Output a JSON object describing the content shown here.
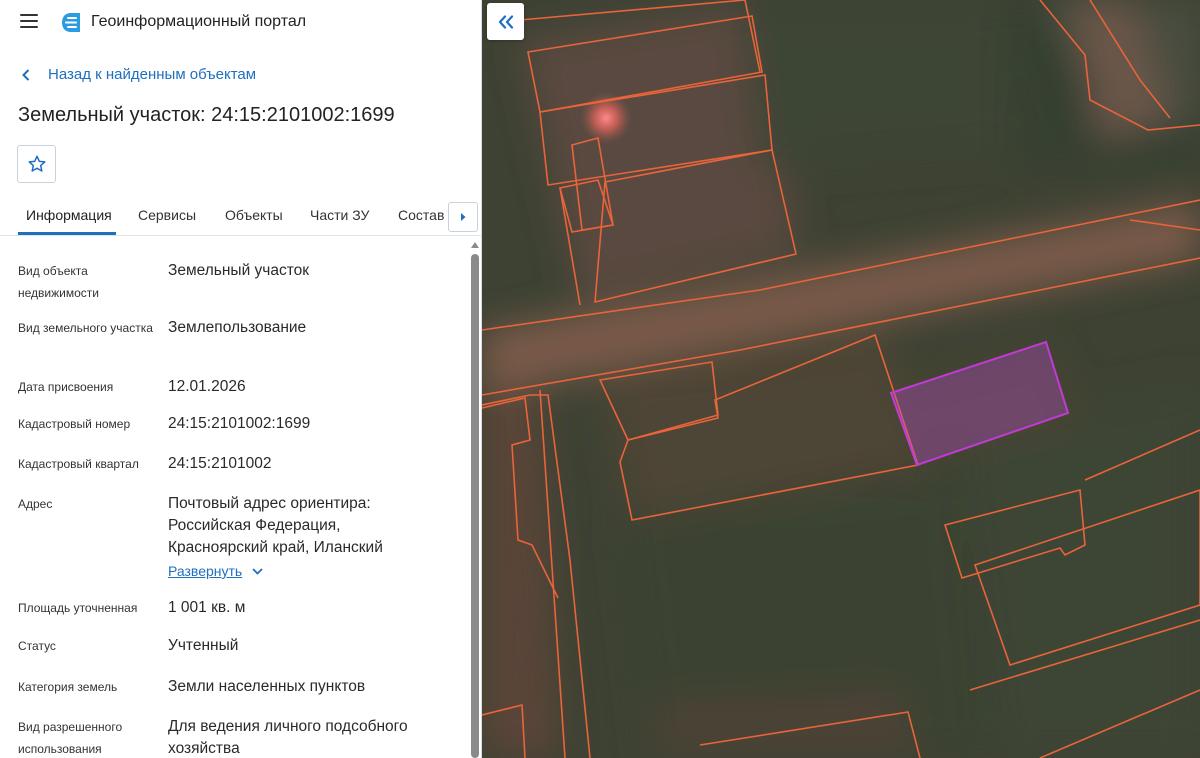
{
  "header": {
    "app_title": "Геоинформационный портал"
  },
  "back_link": "Назад к найденным объектам",
  "page_title": "Земельный участок: 24:15:2101002:1699",
  "tabs": [
    "Информация",
    "Сервисы",
    "Объекты",
    "Части ЗУ",
    "Состав"
  ],
  "info": {
    "object_type": {
      "label": "Вид объекта недвижимости",
      "value": "Земельный участок"
    },
    "land_type": {
      "label": "Вид земельного участка",
      "value": "Землепользование"
    },
    "assign_date": {
      "label": "Дата присвоения",
      "value": "12.01.2026"
    },
    "cad_number": {
      "label": "Кадастровый номер",
      "value": "24:15:2101002:1699"
    },
    "cad_quarter": {
      "label": "Кадастровый квартал",
      "value": "24:15:2101002"
    },
    "address": {
      "label": "Адрес",
      "value": "Почтовый адрес ориентира: Российская Федерация, Красноярский край, Иланский",
      "expand": "Развернуть"
    },
    "area": {
      "label": "Площадь уточненная",
      "value": "1 001 кв. м"
    },
    "status": {
      "label": "Статус",
      "value": "Учтенный"
    },
    "category": {
      "label": "Категория земель",
      "value": "Земли населенных пунктов"
    },
    "permitted_use": {
      "label": "Вид разрешенного использования",
      "value": "Для ведения личного подсобного хозяйства"
    }
  },
  "colors": {
    "accent": "#1e6fc0",
    "parcel_border": "#e8643a",
    "selected_parcel": "#c23ad6"
  },
  "icons": {
    "menu": "hamburger-icon",
    "logo": "portal-logo-icon",
    "back": "chevron-left-icon",
    "favorite": "star-icon",
    "tabs_next": "triangle-right-icon",
    "expand": "chevron-down-icon",
    "collapse_panel": "double-chevron-left-icon"
  }
}
